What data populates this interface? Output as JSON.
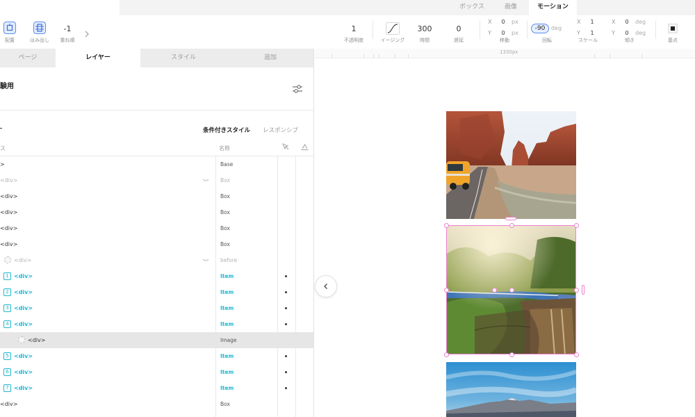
{
  "top_tabs": [
    {
      "label": "ボックス",
      "active": false
    },
    {
      "label": "画像",
      "active": false
    },
    {
      "label": "モーション",
      "active": true
    }
  ],
  "toolbar": {
    "left_items": [
      {
        "icon": "align-icon",
        "label": "配置"
      },
      {
        "icon": "overflow-icon",
        "label": "はみ出し"
      },
      {
        "value": "-1",
        "label": "重ね順"
      }
    ],
    "more_icon": "chevron-right-icon",
    "opacity": {
      "value": "1",
      "label": "不透明度"
    },
    "easing": {
      "icon": "easing-curve-icon",
      "label": "イージング"
    },
    "duration": {
      "value": "300",
      "label": "時間"
    },
    "delay": {
      "value": "0",
      "label": "遅延"
    },
    "move": {
      "x_axis": "X",
      "y_axis": "Y",
      "x": "0",
      "y": "0",
      "unit": "px",
      "label": "移動"
    },
    "rotate": {
      "value": "-90",
      "unit": "deg",
      "label": "回転"
    },
    "scale": {
      "x_axis": "X",
      "y_axis": "Y",
      "x": "1",
      "y": "1",
      "label": "スケール"
    },
    "skew": {
      "x_axis": "X",
      "y_axis": "Y",
      "x": "0",
      "y": "0",
      "unit": "deg",
      "label": "傾き"
    },
    "origin": {
      "icon": "origin-point-icon",
      "label": "基点"
    }
  },
  "panel": {
    "tabs": [
      {
        "label": "ページ",
        "active": false
      },
      {
        "label": "レイヤー",
        "active": true
      },
      {
        "label": "スタイル",
        "active": false
      },
      {
        "label": "追加",
        "active": false
      }
    ],
    "section_title": "験用",
    "filter_icon": "sliders-icon",
    "conditional_style": "条件付きスタイル",
    "responsive": "レスポンシブ",
    "col_tag": "ス",
    "col_name": "名称",
    "col_icons": [
      "pointer-icon",
      "layout-icon"
    ],
    "rows": [
      {
        "tag": ">",
        "name": "Base",
        "kind": "normal",
        "indent": 0
      },
      {
        "tag": "<div>",
        "name": "Box",
        "kind": "faded",
        "indent": 0,
        "chevron": true
      },
      {
        "tag": "<div>",
        "name": "Box",
        "kind": "normal",
        "indent": 0
      },
      {
        "tag": "<div>",
        "name": "Box",
        "kind": "normal",
        "indent": 0
      },
      {
        "tag": "<div>",
        "name": "Box",
        "kind": "normal",
        "indent": 0
      },
      {
        "tag": "<div>",
        "name": "Box",
        "kind": "normal",
        "indent": 0
      },
      {
        "tag": "<div>",
        "name": "before",
        "kind": "faded",
        "indent": 1,
        "placeholder": true,
        "chevron": true
      },
      {
        "tag": "<div>",
        "name": "Item",
        "kind": "item",
        "num": "1",
        "dot": true
      },
      {
        "tag": "<div>",
        "name": "Item",
        "kind": "item",
        "num": "2",
        "dot": true
      },
      {
        "tag": "<div>",
        "name": "Item",
        "kind": "item",
        "num": "3",
        "dot": true
      },
      {
        "tag": "<div>",
        "name": "Item",
        "kind": "item",
        "num": "4",
        "dot": true
      },
      {
        "tag": "<div>",
        "name": "Image",
        "kind": "selected",
        "indent": 2,
        "placeholder": true
      },
      {
        "tag": "<div>",
        "name": "Item",
        "kind": "item",
        "num": "5",
        "dot": true
      },
      {
        "tag": "<div>",
        "name": "Item",
        "kind": "item",
        "num": "6",
        "dot": true
      },
      {
        "tag": "<div>",
        "name": "Item",
        "kind": "item",
        "num": "7",
        "dot": true
      },
      {
        "tag": "<div>",
        "name": "Box",
        "kind": "normal",
        "indent": 0
      }
    ]
  },
  "canvas": {
    "ruler_label": "1330px",
    "collapse_icon": "chevron-left-icon",
    "images": [
      "desert-road-photo",
      "train-bridge-photo",
      "mountain-sky-photo"
    ],
    "selection_color": "#ee80d0"
  }
}
